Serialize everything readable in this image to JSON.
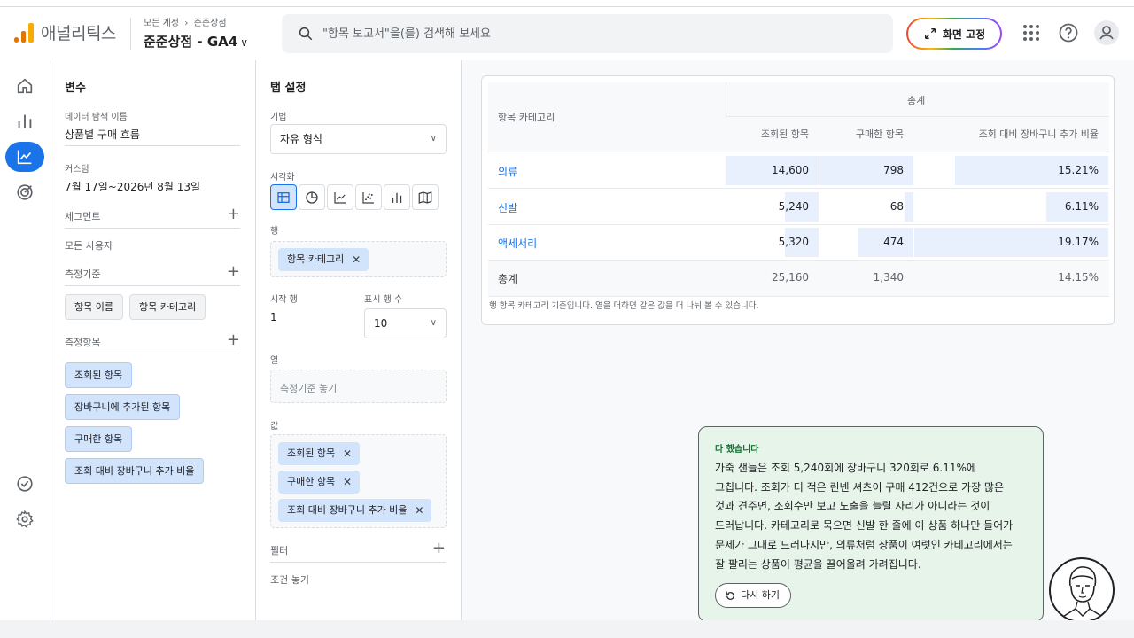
{
  "header": {
    "app_name": "애널리틱스",
    "breadcrumb_root": "모든 계정",
    "breadcrumb_child": "준준상점",
    "property_name": "준준상점 - GA4",
    "search_placeholder": "\"항목 보고서\"을(를) 검색해 보세요",
    "pin_label": "화면 고정"
  },
  "variables": {
    "title": "변수",
    "exploration_name_label": "데이터 탐색 이름",
    "exploration_name": "상품별 구매 흐름",
    "custom_label": "커스텀",
    "date_range": "7월 17일~2026년 8월 13일",
    "segments_label": "세그먼트",
    "segment_value": "모든 사용자",
    "dimensions_label": "측정기준",
    "dimensions": [
      "항목 이름",
      "항목 카테고리"
    ],
    "metrics_label": "측정항목",
    "metrics": [
      "조회된 항목",
      "장바구니에 추가된 항목",
      "구매한 항목",
      "조회 대비 장바구니 추가 비율"
    ]
  },
  "tab_settings": {
    "title": "탭 설정",
    "technique_label": "기법",
    "technique": "자유 형식",
    "visualization_label": "시각화",
    "rows_label": "행",
    "rows_chip": "항목 카테고리",
    "start_row_label": "시작 행",
    "start_row": "1",
    "show_rows_label": "표시 행 수",
    "show_rows": "10",
    "columns_label": "열",
    "columns_placeholder": "측정기준 놓기",
    "values_label": "값",
    "values": [
      "조회된 항목",
      "구매한 항목",
      "조회 대비 장바구니 추가 비율"
    ],
    "filters_label": "필터",
    "filters_placeholder": "조건 놓기"
  },
  "table": {
    "row_header": "항목 카테고리",
    "group_header": "총계",
    "columns": [
      "조회된 항목",
      "구매한 항목",
      "조회 대비 장바구니 추가 비율"
    ],
    "rows": [
      {
        "label": "의류",
        "viewed": "14,600",
        "purchased": "798",
        "ratio": "15.21%",
        "viewed_frac": 1.0,
        "purchased_frac": 1.0,
        "ratio_frac": 0.79
      },
      {
        "label": "신발",
        "viewed": "5,240",
        "purchased": "68",
        "ratio": "6.11%",
        "viewed_frac": 0.36,
        "purchased_frac": 0.09,
        "ratio_frac": 0.32
      },
      {
        "label": "액세서리",
        "viewed": "5,320",
        "purchased": "474",
        "ratio": "19.17%",
        "viewed_frac": 0.36,
        "purchased_frac": 0.59,
        "ratio_frac": 1.0
      }
    ],
    "total_label": "총계",
    "total_viewed": "25,160",
    "total_purchased": "1,340",
    "total_ratio": "14.15%",
    "footnote": "행 항목 카테고리 기준입니다. 열을 더하면 같은 값을 더 나눠 볼 수 있습니다."
  },
  "assistant": {
    "status": "다 했습니다",
    "lines": [
      "가죽 샌들은 조회 5,240회에 장바구니 320회로 6.11%에",
      "그칩니다. 조회가 더 적은 린넨 셔츠이 구매 412건으로 가장 많은",
      "것과 견주면, 조회수만 보고 노출을 늘릴 자리가 아니라는 것이",
      "드러납니다. 카테고리로 묶으면 신발 한 줄에 이 상품 하나만 들어가",
      "문제가 그대로 드러나지만, 의류처럼 상품이 여럿인 카테고리에서는",
      "잘 팔리는 상품이 평균을 끌어올려 가려집니다."
    ],
    "retry_label": "다시 하기"
  }
}
